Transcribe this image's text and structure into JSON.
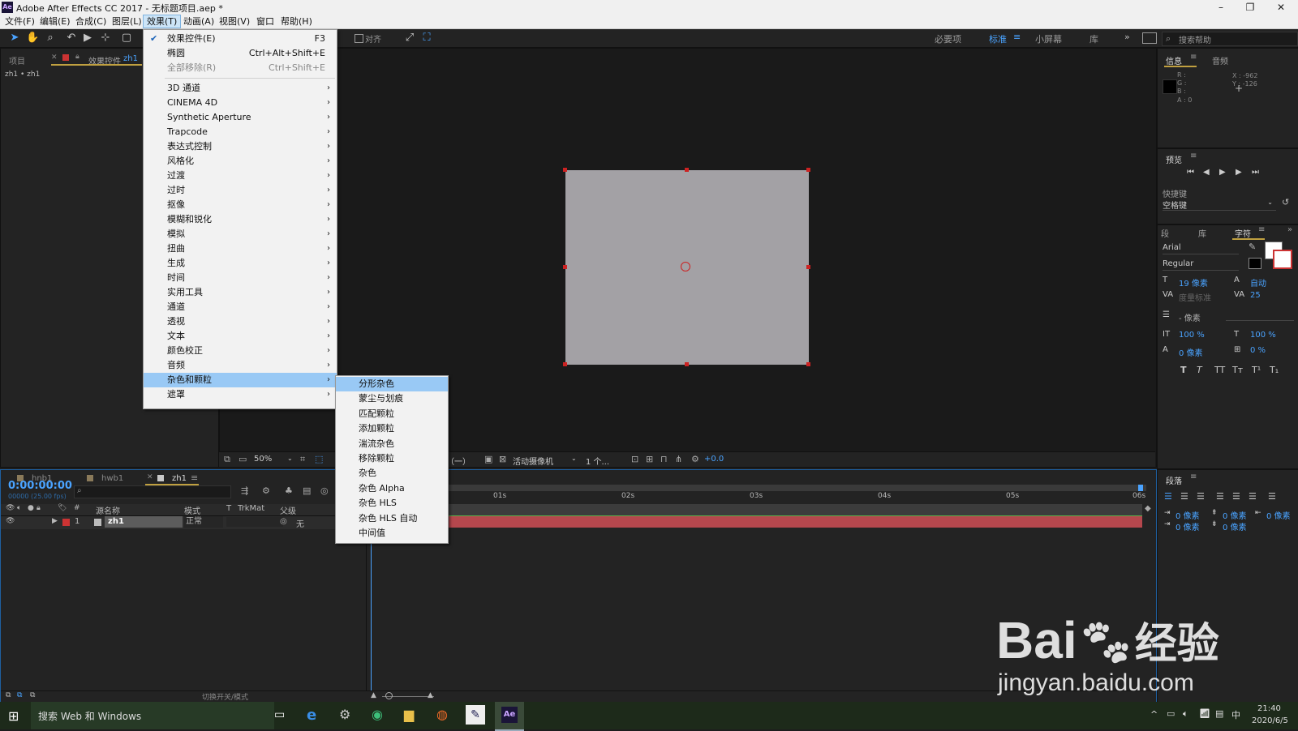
{
  "window": {
    "title": "Adobe After Effects CC 2017 - 无标题项目.aep *",
    "logo": "Ae",
    "minimize": "–",
    "restore": "❐",
    "close": "✕"
  },
  "menubar": [
    "文件(F)",
    "编辑(E)",
    "合成(C)",
    "图层(L)",
    "效果(T)",
    "动画(A)",
    "视图(V)",
    "窗口",
    "帮助(H)"
  ],
  "toolbar": {
    "align_label": "对齐",
    "workspaces": [
      "必要项",
      "标准",
      "小屏幕",
      "库"
    ],
    "search_placeholder": "搜索帮助"
  },
  "project_panel": {
    "tab_project": "项目",
    "tab_effects": "效果控件",
    "tab_effects_layer": "zh1",
    "breadcrumb": "zh1 • zh1"
  },
  "effects_menu": {
    "items": [
      {
        "label": "效果控件(E)",
        "shortcut": "F3",
        "checked": true
      },
      {
        "label": "椭圆",
        "shortcut": "Ctrl+Alt+Shift+E"
      },
      {
        "label": "全部移除(R)",
        "shortcut": "Ctrl+Shift+E",
        "disabled": true
      },
      {
        "label": "3D 通道",
        "submenu": true
      },
      {
        "label": "CINEMA 4D",
        "submenu": true
      },
      {
        "label": "Synthetic Aperture",
        "submenu": true
      },
      {
        "label": "Trapcode",
        "submenu": true
      },
      {
        "label": "表达式控制",
        "submenu": true
      },
      {
        "label": "风格化",
        "submenu": true
      },
      {
        "label": "过渡",
        "submenu": true
      },
      {
        "label": "过时",
        "submenu": true
      },
      {
        "label": "抠像",
        "submenu": true
      },
      {
        "label": "模糊和锐化",
        "submenu": true
      },
      {
        "label": "模拟",
        "submenu": true
      },
      {
        "label": "扭曲",
        "submenu": true
      },
      {
        "label": "生成",
        "submenu": true
      },
      {
        "label": "时间",
        "submenu": true
      },
      {
        "label": "实用工具",
        "submenu": true
      },
      {
        "label": "通道",
        "submenu": true
      },
      {
        "label": "透视",
        "submenu": true
      },
      {
        "label": "文本",
        "submenu": true
      },
      {
        "label": "颜色校正",
        "submenu": true
      },
      {
        "label": "音频",
        "submenu": true
      },
      {
        "label": "杂色和颗粒",
        "submenu": true,
        "highlighted": true
      },
      {
        "label": "遮罩",
        "submenu": true
      }
    ]
  },
  "noise_submenu": {
    "items": [
      "分形杂色",
      "蒙尘与划痕",
      "匹配颗粒",
      "添加颗粒",
      "湍流杂色",
      "移除颗粒",
      "杂色",
      "杂色 Alpha",
      "杂色 HLS",
      "杂色 HLS 自动",
      "中间值"
    ]
  },
  "viewer_bar": {
    "zoom": "50%",
    "view_mode": "（一）",
    "camera": "活动摄像机",
    "views": "1 个...",
    "exposure": "+0.0"
  },
  "timeline": {
    "tabs": [
      "hnb1",
      "hwb1",
      "zh1"
    ],
    "timecode": "0:00:00:00",
    "frame_info": "00000 (25.00 fps)",
    "columns": {
      "name": "源名称",
      "mode": "模式",
      "t": "T",
      "trkmat": "TrkMat",
      "parent": "父级"
    },
    "layer": {
      "index": "1",
      "name": "zh1",
      "mode": "正常",
      "parent": "无"
    },
    "ruler": [
      "01s",
      "02s",
      "03s",
      "04s",
      "05s",
      "06s"
    ],
    "footer": "切换开关/模式"
  },
  "info_panel": {
    "tab_info": "信息",
    "tab_audio": "音频",
    "rgba": [
      "R :",
      "G :",
      "B :",
      "A : 0"
    ],
    "x": "X : -962",
    "y": "Y : -126"
  },
  "preview_panel": {
    "title": "预览",
    "shortcut_label": "快捷键",
    "shortcut_value": "空格键"
  },
  "character_panel": {
    "tabs": [
      "段",
      "库",
      "字符"
    ],
    "font": "Arial",
    "style": "Regular",
    "size": "19 像素",
    "leading": "自动",
    "kerning": "度量标准",
    "tracking": "25",
    "stroke": "- 像素",
    "vscale": "100 %",
    "hscale": "100 %",
    "baseline": "0 像素",
    "tsume": "0 %",
    "styles": [
      "T",
      "T",
      "TT",
      "Tт",
      "T¹",
      "T₁"
    ]
  },
  "paragraph_panel": {
    "title": "段落",
    "indent": [
      "0 像素",
      "0 像素",
      "0 像素",
      "0 像素",
      "0 像素"
    ]
  },
  "taskbar": {
    "search": "搜索 Web 和 Windows",
    "time": "21:40",
    "date": "2020/6/5",
    "ime": "中"
  },
  "watermark": {
    "brand": "Bai",
    "brand2": "经验",
    "url": "jingyan.baidu.com"
  },
  "colors": {
    "menu_highlight": "#99c9f5",
    "accent_blue": "#2d8ceb",
    "layer_bar": "#b5474d",
    "solid": "#a3a1a5"
  }
}
